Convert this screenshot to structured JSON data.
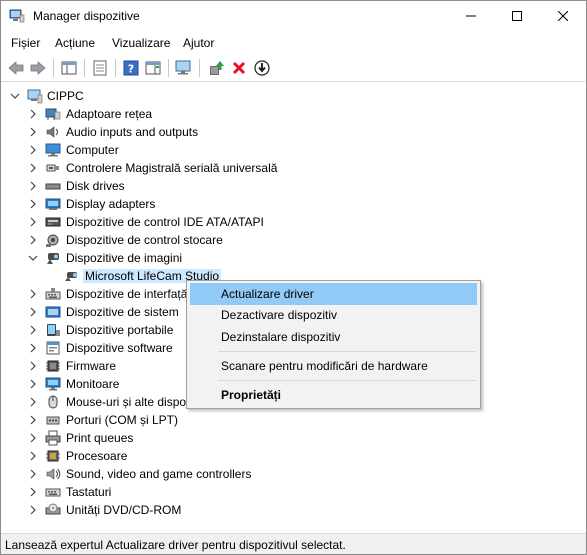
{
  "window": {
    "title": "Manager dispozitive"
  },
  "menu": [
    "Fișier",
    "Acțiune",
    "Vizualizare",
    "Ajutor"
  ],
  "tree": {
    "root": "CIPPC",
    "categories": [
      {
        "label": "Adaptoare rețea",
        "icon": "network-adapter-icon"
      },
      {
        "label": "Audio inputs and outputs",
        "icon": "speaker-icon"
      },
      {
        "label": "Computer",
        "icon": "computer-icon"
      },
      {
        "label": "Controlere Magistrală serială universală",
        "icon": "usb-icon"
      },
      {
        "label": "Disk drives",
        "icon": "disk-drive-icon"
      },
      {
        "label": "Display adapters",
        "icon": "display-adapter-icon"
      },
      {
        "label": "Dispozitive de control IDE ATA/ATAPI",
        "icon": "ide-controller-icon"
      },
      {
        "label": "Dispozitive de control stocare",
        "icon": "storage-controller-icon"
      },
      {
        "label": "Dispozitive de imagini",
        "icon": "camera-icon",
        "expanded": true
      },
      {
        "label": "Dispozitive de interfață",
        "icon": "hid-icon"
      },
      {
        "label": "Dispozitive de sistem",
        "icon": "system-device-icon"
      },
      {
        "label": "Dispozitive portabile",
        "icon": "portable-device-icon"
      },
      {
        "label": "Dispozitive software",
        "icon": "software-device-icon"
      },
      {
        "label": "Firmware",
        "icon": "firmware-icon"
      },
      {
        "label": "Monitoare",
        "icon": "monitor-icon"
      },
      {
        "label": "Mouse-uri și alte dispozitive de indicare",
        "icon": "mouse-icon"
      },
      {
        "label": "Porturi (COM și LPT)",
        "icon": "port-icon"
      },
      {
        "label": "Print queues",
        "icon": "printer-icon"
      },
      {
        "label": "Procesoare",
        "icon": "processor-icon"
      },
      {
        "label": "Sound, video and game controllers",
        "icon": "sound-icon"
      },
      {
        "label": "Tastaturi",
        "icon": "keyboard-icon"
      },
      {
        "label": "Unități DVD/CD-ROM",
        "icon": "dvd-icon"
      }
    ],
    "child_of_imaging": "Microsoft LifeCam Studio"
  },
  "context_menu": {
    "items": [
      "Actualizare driver",
      "Dezactivare dispozitiv",
      "Dezinstalare dispozitiv",
      "Scanare pentru modificări de hardware",
      "Proprietăți"
    ],
    "highlighted": "Actualizare driver"
  },
  "status": "Lansează expertul Actualizare driver pentru dispozitivul selectat.",
  "colors": {
    "selection": "#cce8ff",
    "menu_highlight": "#91c9f7",
    "remove_red": "#e81123",
    "update_green": "#2e9e3c"
  }
}
